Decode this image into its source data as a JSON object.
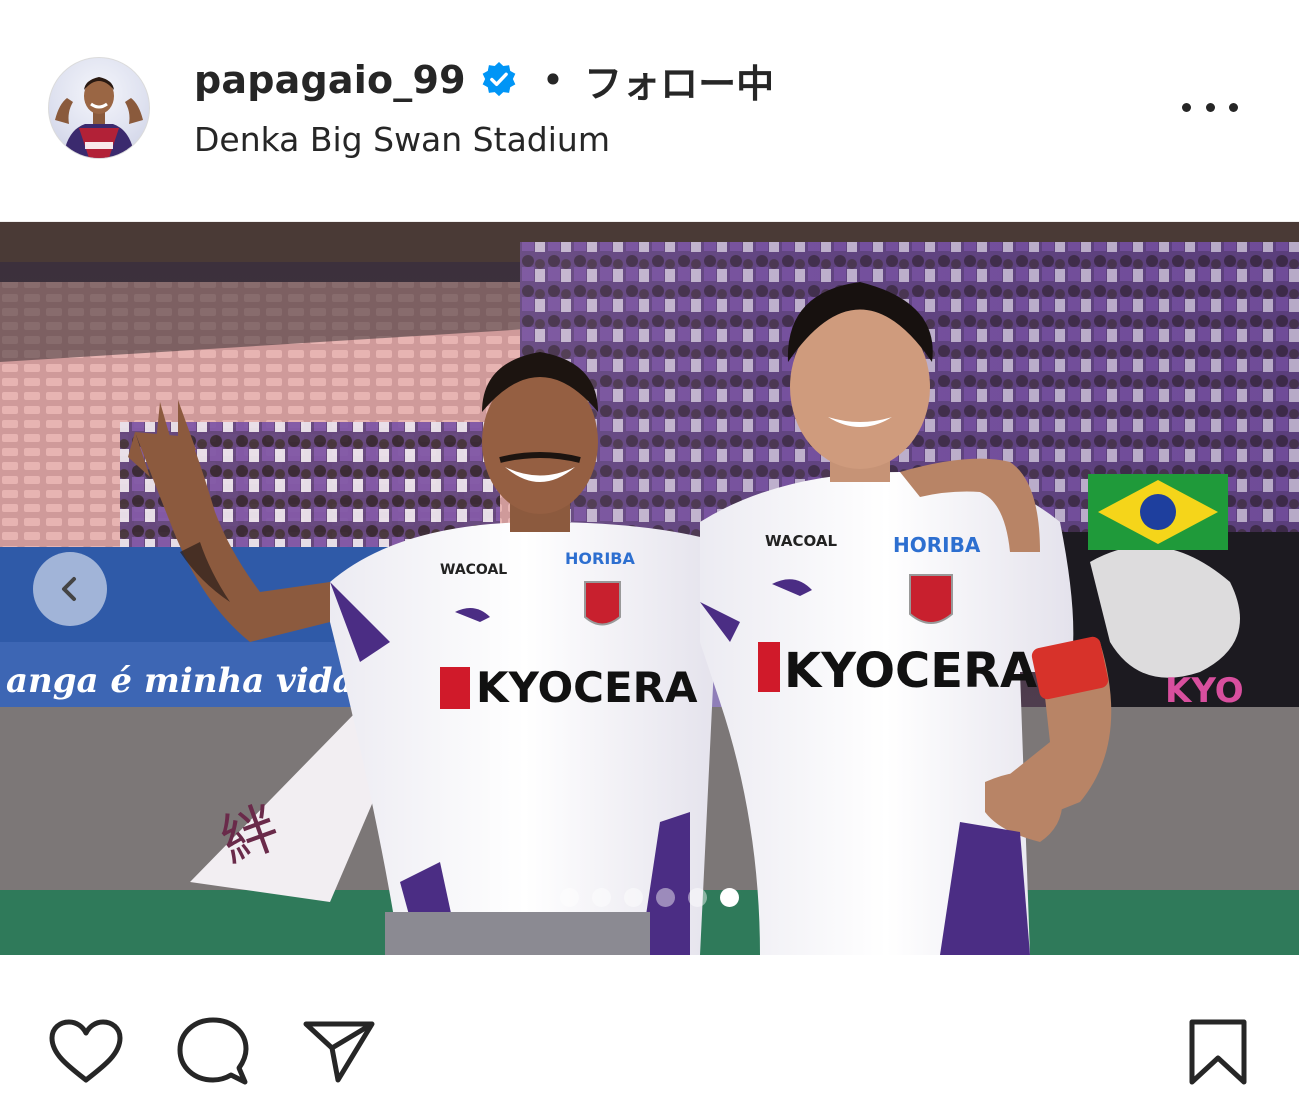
{
  "post": {
    "username": "papagaio_99",
    "verified_icon": "verified-badge-icon",
    "separator": "•",
    "follow_state": "フォロー中",
    "location": "Denka Big Swan Stadium",
    "more_icon": "more-options-icon"
  },
  "media": {
    "carousel_total": 6,
    "carousel_active_index": 6,
    "prev_icon": "chevron-left-icon",
    "jersey_text_left": "KYOCERA",
    "jersey_text_right": "KYOCERA",
    "sponsor_1": "WACOAL",
    "sponsor_2": "HORIBA",
    "banner_text": "anga é minha vida"
  },
  "actions": {
    "like_icon": "heart-icon",
    "comment_icon": "comment-icon",
    "share_icon": "paper-plane-icon",
    "save_icon": "bookmark-icon"
  },
  "colors": {
    "verified": "#0095f6",
    "text": "#262626",
    "jersey_purple": "#4b2d84"
  }
}
